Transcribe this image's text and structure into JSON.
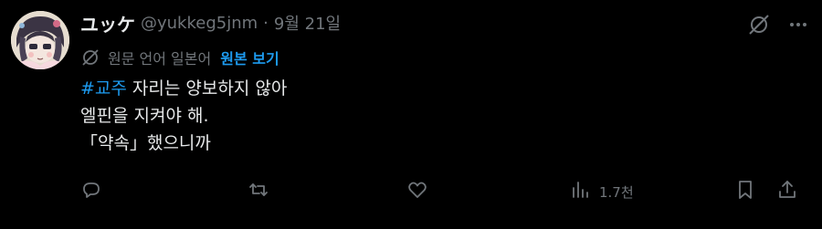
{
  "post": {
    "author": {
      "display_name": "ユッケ",
      "handle": "@yukkeg5jnm",
      "separator": "·",
      "date": "9월 21일"
    },
    "translate": {
      "label": "원문 언어 일본어",
      "link_text": "원본 보기"
    },
    "text": {
      "hashtag": "#교주",
      "line1_rest": " 자리는 양보하지 않아",
      "line2": "엘핀을 지켜야 해.",
      "line3": "「약속」했으니까"
    },
    "actions": {
      "views": "1.7천"
    },
    "icons": {
      "header": [
        "grok-slash-icon",
        "more-icon"
      ],
      "translate": "translate-icon",
      "action_bar": [
        "reply-icon",
        "repost-icon",
        "like-icon",
        "views-icon",
        "bookmark-icon",
        "share-icon"
      ]
    },
    "colors": {
      "background": "#000000",
      "text": "#e7e9ea",
      "muted": "#71767b",
      "accent": "#1d9bf0"
    }
  }
}
